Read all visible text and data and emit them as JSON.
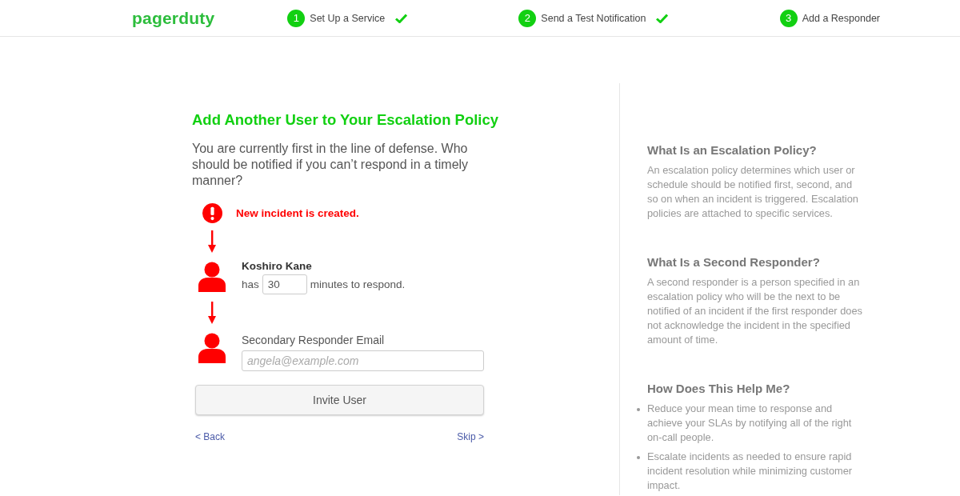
{
  "header": {
    "logo": "pagerduty",
    "steps": [
      {
        "number": "1",
        "label": "Set Up a Service",
        "completed": true
      },
      {
        "number": "2",
        "label": "Send a Test Notification",
        "completed": true
      },
      {
        "number": "3",
        "label": "Add a Responder",
        "completed": false
      }
    ]
  },
  "main": {
    "title": "Add Another User to Your Escalation Policy",
    "intro": "You are currently first in the line of defense. Who should be notified if you can’t respond in a timely manner?",
    "flow": [
      {
        "kind": "incident",
        "text": "New incident is created."
      },
      {
        "kind": "responder",
        "name": "Koshiro Kane",
        "prefix": "has",
        "minutes": "30",
        "suffix": "minutes to respond."
      },
      {
        "kind": "new_responder",
        "label": "Secondary Responder Email",
        "placeholder": "angela@example.com"
      }
    ],
    "invite_button": "Invite User",
    "back_link": "< Back",
    "skip_link": "Skip >"
  },
  "sidebar": {
    "sections": [
      {
        "kind": "paragraph",
        "title": "What Is an Escalation Policy?",
        "text": "An escalation policy determines which user or schedule should be notified first, second, and so on when an incident is triggered. Escalation policies are attached to specific services."
      },
      {
        "kind": "paragraph",
        "title": "What Is a Second Responder?",
        "text": "A second responder is a person specified in an escalation policy who will be the next to be notified of an incident if the first responder does not acknowledge the incident in the specified amount of time."
      },
      {
        "kind": "bullets",
        "title": "How Does This Help Me?",
        "items": [
          "Reduce your mean time to response and achieve your SLAs by notifying all of the right on-call people.",
          "Escalate incidents as needed to ensure rapid incident resolution while minimizing customer impact."
        ]
      }
    ]
  }
}
